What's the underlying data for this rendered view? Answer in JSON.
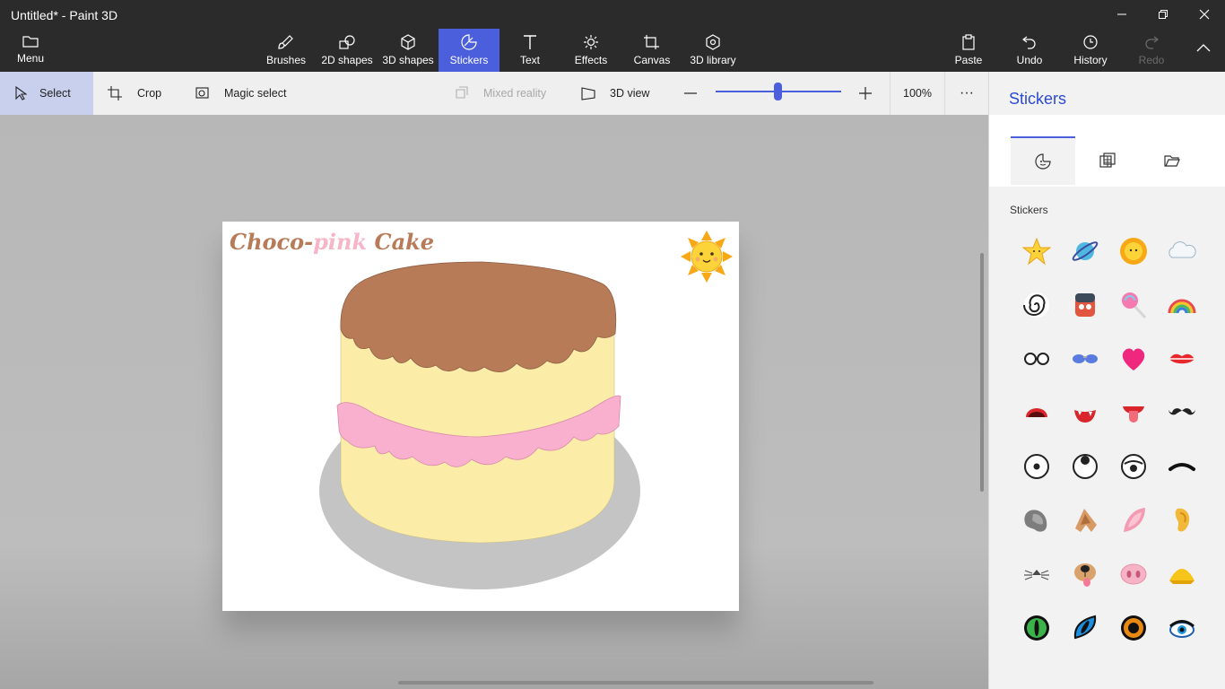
{
  "window": {
    "title": "Untitled* - Paint 3D"
  },
  "ribbon": {
    "menu_label": "Menu",
    "tools": [
      {
        "label": "Brushes"
      },
      {
        "label": "2D shapes"
      },
      {
        "label": "3D shapes"
      },
      {
        "label": "Stickers",
        "active": true
      },
      {
        "label": "Text"
      },
      {
        "label": "Effects"
      },
      {
        "label": "Canvas"
      },
      {
        "label": "3D library"
      }
    ],
    "right": [
      {
        "label": "Paste"
      },
      {
        "label": "Undo"
      },
      {
        "label": "History"
      },
      {
        "label": "Redo",
        "disabled": true
      }
    ]
  },
  "commandbar": {
    "select": "Select",
    "crop": "Crop",
    "magic_select": "Magic select",
    "mixed_reality": "Mixed reality",
    "view_3d": "3D view",
    "zoom": "100%",
    "more": "···"
  },
  "canvas": {
    "heading": {
      "part1": "Choco-",
      "part2": "pink",
      "part3": " Cake"
    }
  },
  "panel": {
    "title": "Stickers",
    "section": "Stickers",
    "stickers": [
      "star",
      "planet",
      "sun",
      "cloud",
      "spiral",
      "monster",
      "lollipop",
      "rainbow",
      "glasses",
      "sunglasses",
      "heart",
      "lips",
      "mouth-open",
      "mouth-fangs",
      "mouth-tongue",
      "mustache",
      "eye-round",
      "eye-look-up",
      "eye-frown",
      "eyebrow",
      "ear-grey",
      "ear-dog",
      "ear-pink",
      "ear-human",
      "nose-whiskers",
      "nose-dog",
      "nose-pig",
      "nose-beak",
      "eye-cat-green",
      "eye-cat-blue",
      "eye-orange",
      "eye-lash"
    ]
  },
  "colors": {
    "accent": "#4b5fdc",
    "chocolate": "#b87b58",
    "cream": "#fbeca7",
    "pink": "#f9b0cf"
  }
}
